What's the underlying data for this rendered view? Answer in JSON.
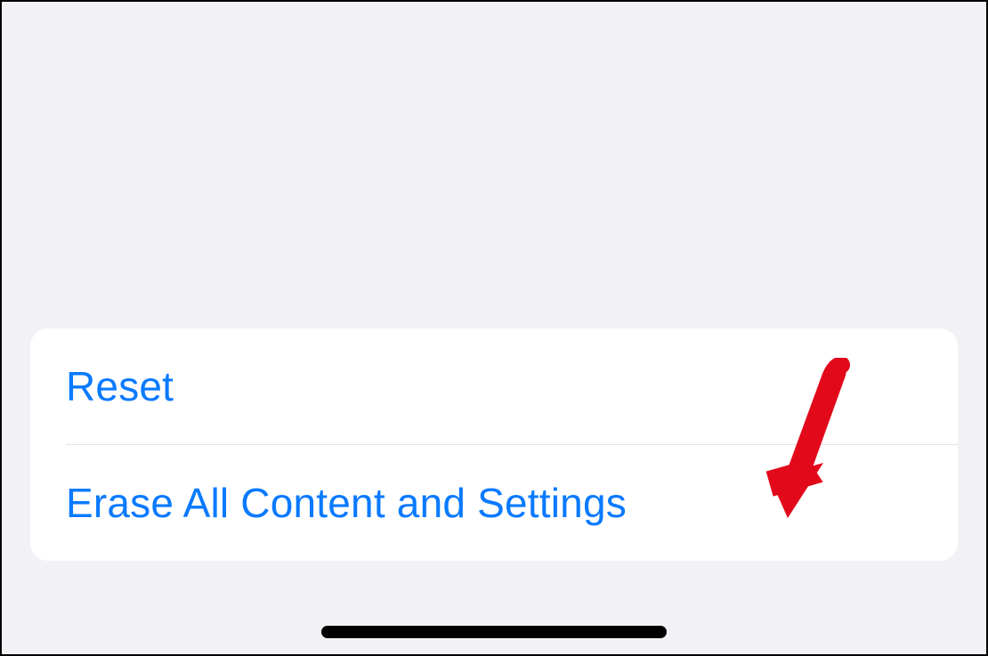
{
  "settings": {
    "items": [
      {
        "label": "Reset"
      },
      {
        "label": "Erase All Content and Settings"
      }
    ]
  },
  "colors": {
    "link": "#0a7aff",
    "background": "#f2f2f6",
    "card": "#ffffff",
    "annotation": "#e2091b"
  }
}
